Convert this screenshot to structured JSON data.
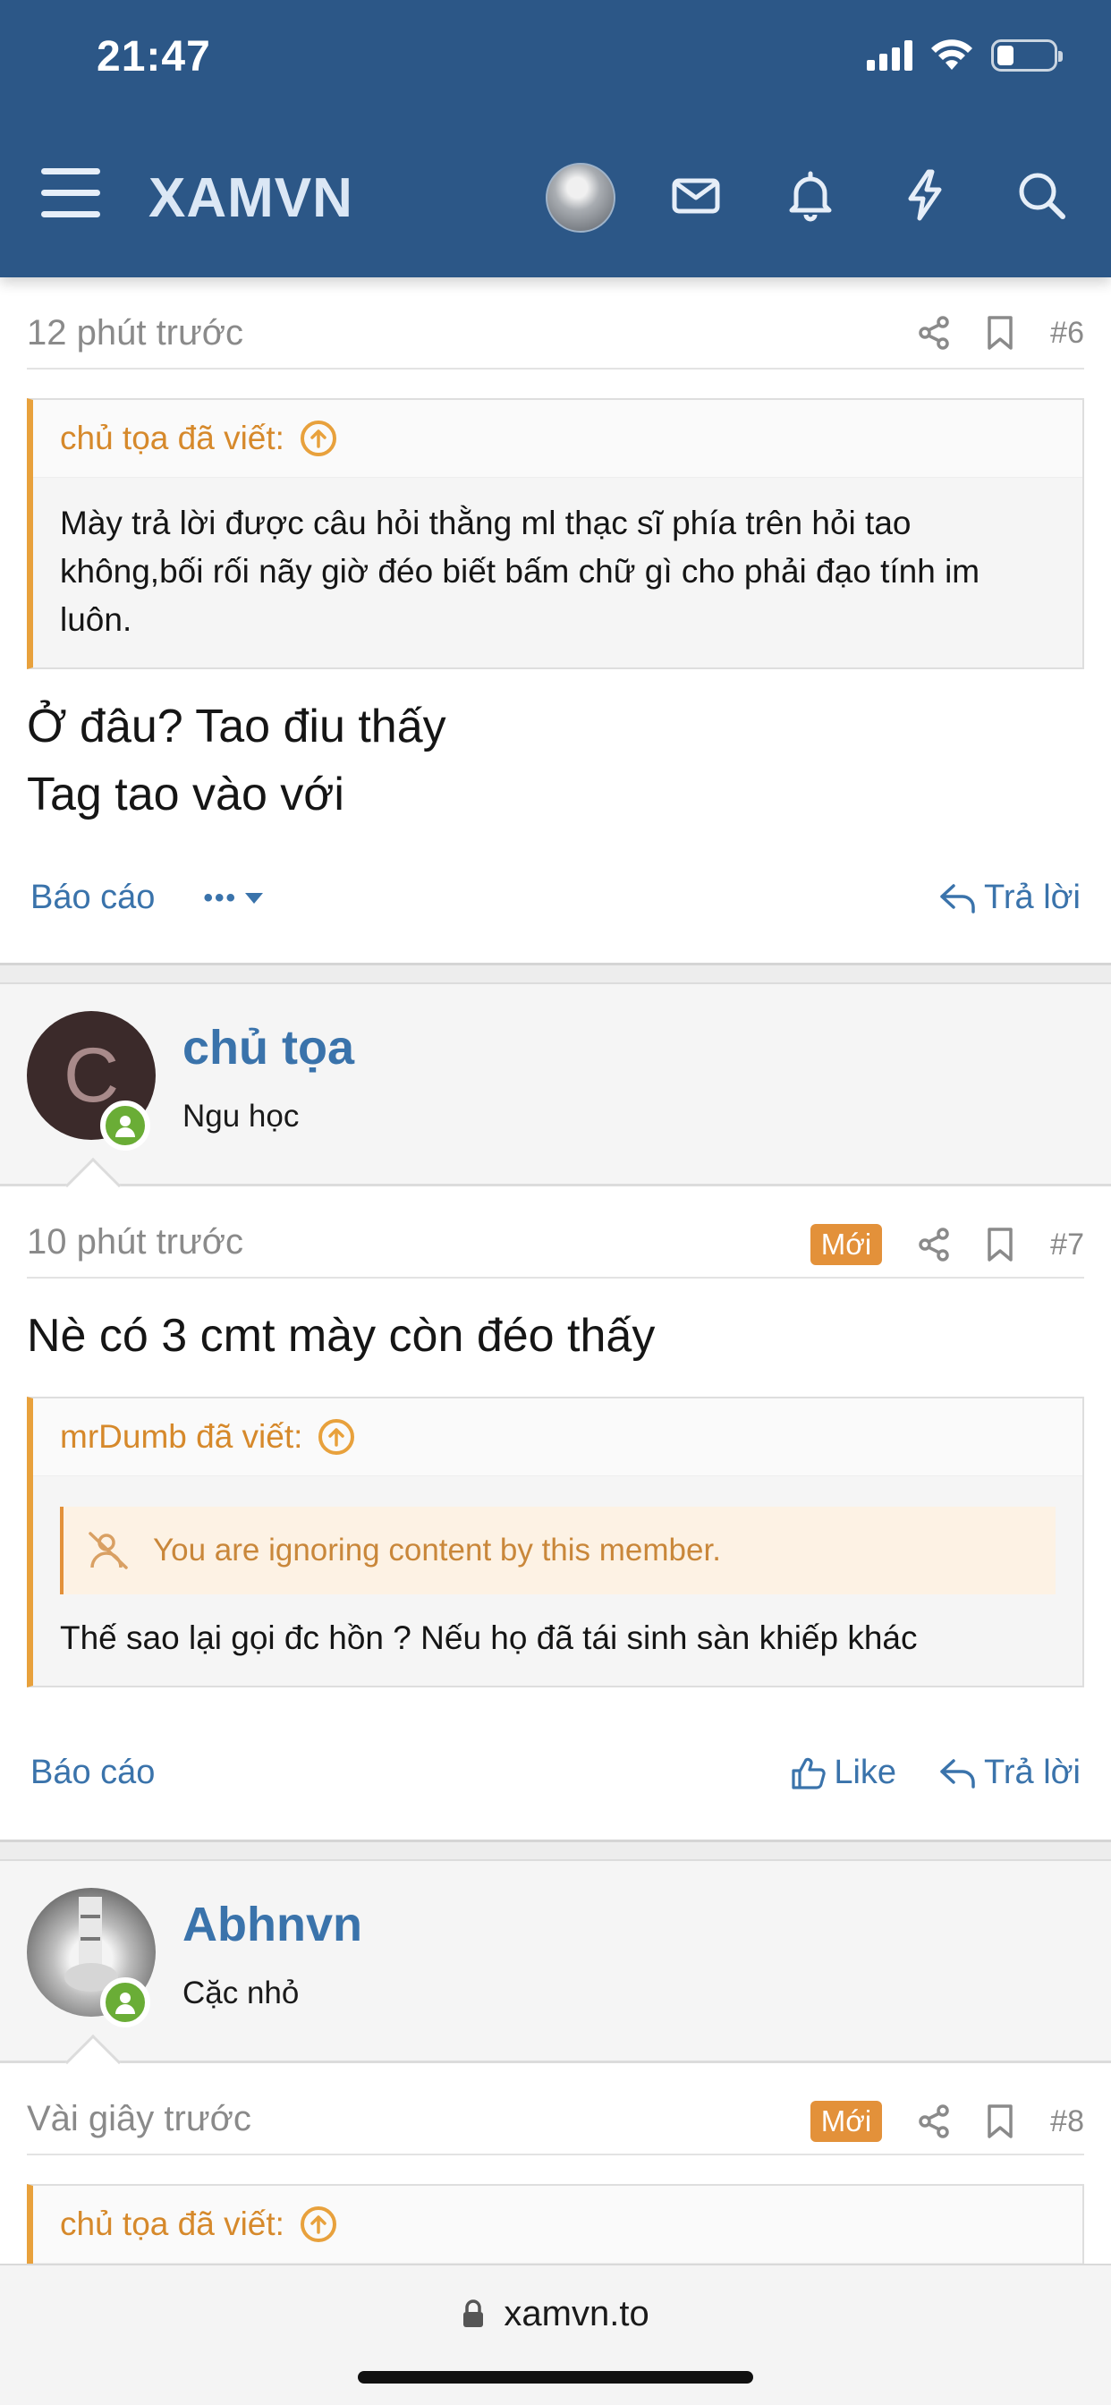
{
  "status_bar": {
    "time": "21:47",
    "battery_level": 0.3
  },
  "nav": {
    "title": "XAMVN",
    "icons": [
      "menu-icon",
      "avatar",
      "mail-icon",
      "bell-icon",
      "lightning-icon",
      "search-icon"
    ]
  },
  "post6": {
    "time": "12 phút trước",
    "number": "#6",
    "quote": {
      "author_line": "chủ tọa đã viết:",
      "text": "Mày trả lời được câu hỏi thằng ml thạc sĩ phía trên hỏi tao không,bối rối nãy giờ đéo biết bấm chữ gì cho phải đạo tính im luôn."
    },
    "text_line1": "Ở đâu? Tao điu thấy",
    "text_line2": "Tag tao vào với",
    "report": "Báo cáo",
    "more": "•••",
    "reply": "Trả lời"
  },
  "user7": {
    "initial": "C",
    "name": "chủ tọa",
    "title": "Ngu học",
    "avatar_color": "#3b2a2a",
    "initial_color": "#a88a8a"
  },
  "post7": {
    "time": "10 phút trước",
    "badge": "Mới",
    "number": "#7",
    "text": "Nè có 3 cmt mày còn đéo thấy",
    "quote": {
      "author_line": "mrDumb đã viết:",
      "ignore_notice": "You are ignoring content by this member.",
      "text": "Thế sao lại gọi đc hồn ? Nếu họ đã tái sinh sàn khiếp khác"
    },
    "report": "Báo cáo",
    "like": "Like",
    "reply": "Trả lời"
  },
  "user8": {
    "name": "Abhnvn",
    "title": "Cặc nhỏ"
  },
  "post8": {
    "time": "Vài giây trước",
    "badge": "Mới",
    "number": "#8",
    "quote": {
      "author_line": "chủ tọa đã viết:"
    }
  },
  "browser": {
    "url": "xamvn.to"
  },
  "colors": {
    "header": "#2c5787",
    "link": "#3a73ab",
    "quote_accent": "#e8a13c",
    "badge": "#e3913a",
    "online": "#6aad36"
  }
}
